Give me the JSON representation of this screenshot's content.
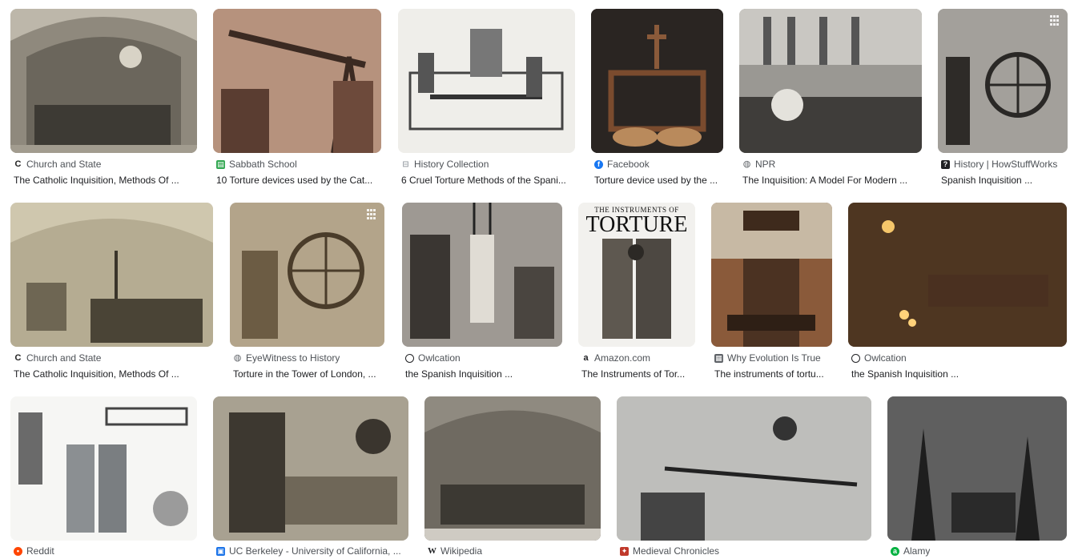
{
  "results": [
    {
      "source": "Church and State",
      "title": "The Catholic Inquisition, Methods Of ...",
      "favicon": "c-icon",
      "favicon_color": "#222222",
      "tone": "#b9b3a6"
    },
    {
      "source": "Sabbath School",
      "title": "10 Torture devices used by the Cat...",
      "favicon": "book-icon",
      "favicon_color": "#34a853",
      "tone": "#a9806c"
    },
    {
      "source": "History Collection",
      "title": "6 Cruel Torture Methods of the Spani...",
      "favicon": "h-icon",
      "favicon_color": "#9aa0a6",
      "tone": "#e8e6e1"
    },
    {
      "source": "Facebook",
      "title": "Torture device used by the ...",
      "favicon": "facebook-icon",
      "favicon_color": "#1877f2",
      "tone": "#2a2522"
    },
    {
      "source": "NPR",
      "title": "The Inquisition: A Model For Modern ...",
      "favicon": "globe-icon",
      "favicon_color": "#5f6368",
      "tone": "#8c8a86"
    },
    {
      "source": "History | HowStuffWorks",
      "title": "Spanish Inquisition ...",
      "favicon": "question-icon",
      "favicon_color": "#202124",
      "tone": "#7e7b76"
    },
    {
      "source": "Church and State",
      "title": "The Catholic Inquisition, Methods Of ...",
      "favicon": "c-icon",
      "favicon_color": "#222222",
      "tone": "#c8bfa6"
    },
    {
      "source": "EyeWitness to History",
      "title": "Torture in the Tower of London, ...",
      "favicon": "globe-icon",
      "favicon_color": "#5f6368",
      "tone": "#9e8f78"
    },
    {
      "source": "Owlcation",
      "title": "the Spanish Inquisition ...",
      "favicon": "circle-icon",
      "favicon_color": "#202124",
      "tone": "#7a7570"
    },
    {
      "source": "Amazon.com",
      "title": "The Instruments of Tor...",
      "favicon": "amazon-icon",
      "favicon_color": "#202124",
      "tone": "#f2f1ee"
    },
    {
      "source": "Why Evolution Is True",
      "title": "The instruments of tortu...",
      "favicon": "film-icon",
      "favicon_color": "#5f6368",
      "tone": "#6a4530"
    },
    {
      "source": "Owlcation",
      "title": "the Spanish Inquisition ...",
      "favicon": "circle-icon",
      "favicon_color": "#202124",
      "tone": "#3a2a1c"
    },
    {
      "source": "Reddit",
      "title": "",
      "favicon": "reddit-icon",
      "favicon_color": "#ff4500",
      "tone": "#eeeeee"
    },
    {
      "source": "UC Berkeley - University of California, ...",
      "title": "",
      "favicon": "image-icon",
      "favicon_color": "#1a73e8",
      "tone": "#8d8676"
    },
    {
      "source": "Wikipedia",
      "title": "",
      "favicon": "wikipedia-icon",
      "favicon_color": "#202124",
      "tone": "#8f8a80"
    },
    {
      "source": "Medieval Chronicles",
      "title": "",
      "favicon": "chronicle-icon",
      "favicon_color": "#c0392b",
      "tone": "#bcbcb8"
    },
    {
      "source": "Alamy",
      "title": "",
      "favicon": "alamy-icon",
      "favicon_color": "#00b140",
      "tone": "#454545"
    }
  ],
  "overlay_text": {
    "torture_book_heading": "THE INSTRUMENTS OF",
    "torture_book_title": "TORTURE"
  }
}
